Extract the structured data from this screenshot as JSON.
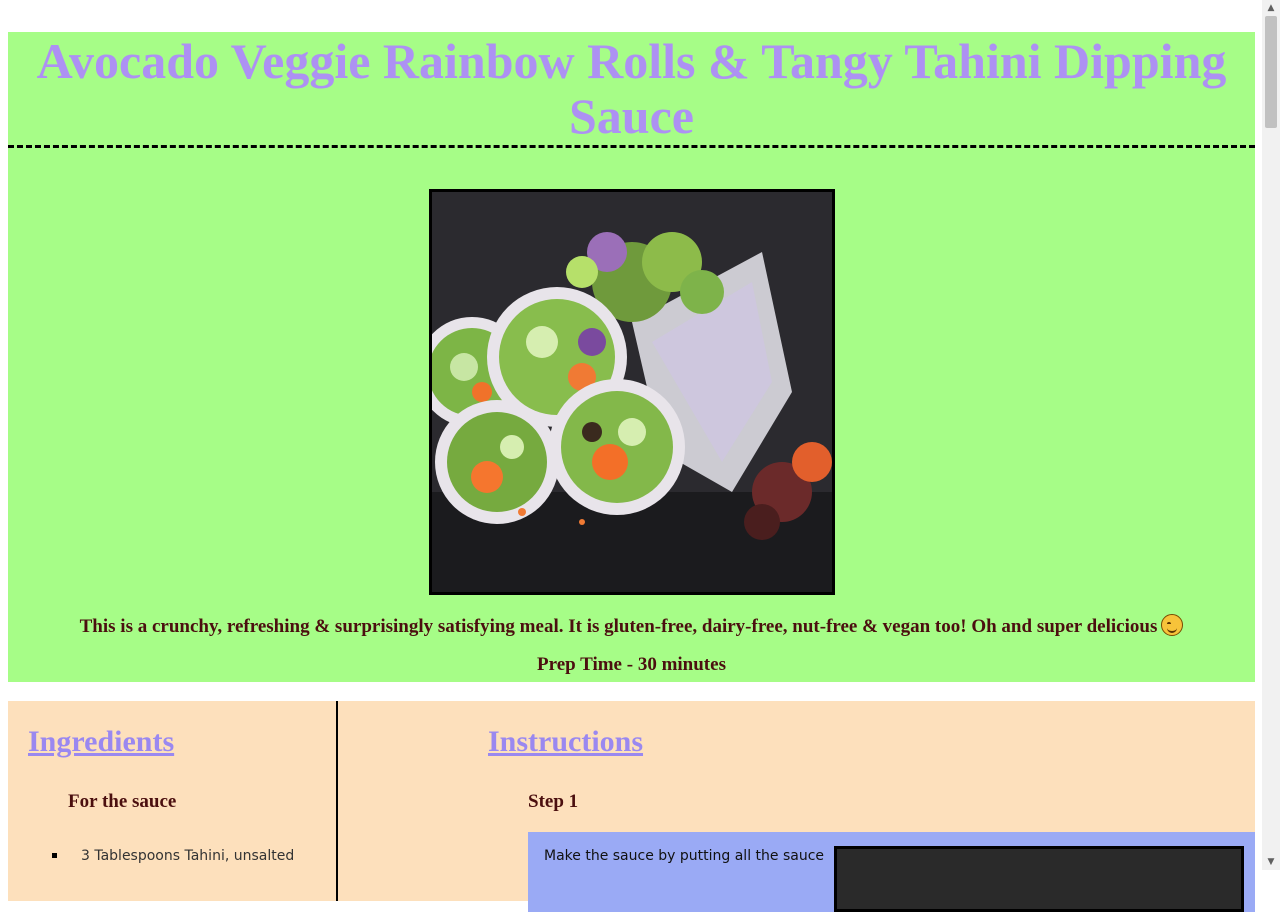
{
  "title": "Avocado Veggie Rainbow Rolls & Tangy Tahini Dipping Sauce",
  "hero": {
    "image_alt": "Avocado veggie rainbow rolls",
    "description": "This is a crunchy, refreshing & surprisingly satisfying meal. It is gluten-free, dairy-free, nut-free & vegan too! Oh and super delicious",
    "emoji": "smiling-face-emoji",
    "prep_time": "Prep Time - 30 minutes"
  },
  "ingredients": {
    "heading": "Ingredients",
    "sauce_heading": "For the sauce",
    "items": [
      "3 Tablespoons Tahini, unsalted"
    ]
  },
  "instructions": {
    "heading": "Instructions",
    "step_label": "Step 1",
    "step_text": "Make the sauce by putting all the sauce"
  },
  "colors": {
    "header_bg": "#a6fd87",
    "title": "#ad91f3",
    "lower_bg": "#fde0bc",
    "step_card": "#9aaaf5",
    "body_text": "#4b0f0f",
    "link": "#9a88f0"
  }
}
